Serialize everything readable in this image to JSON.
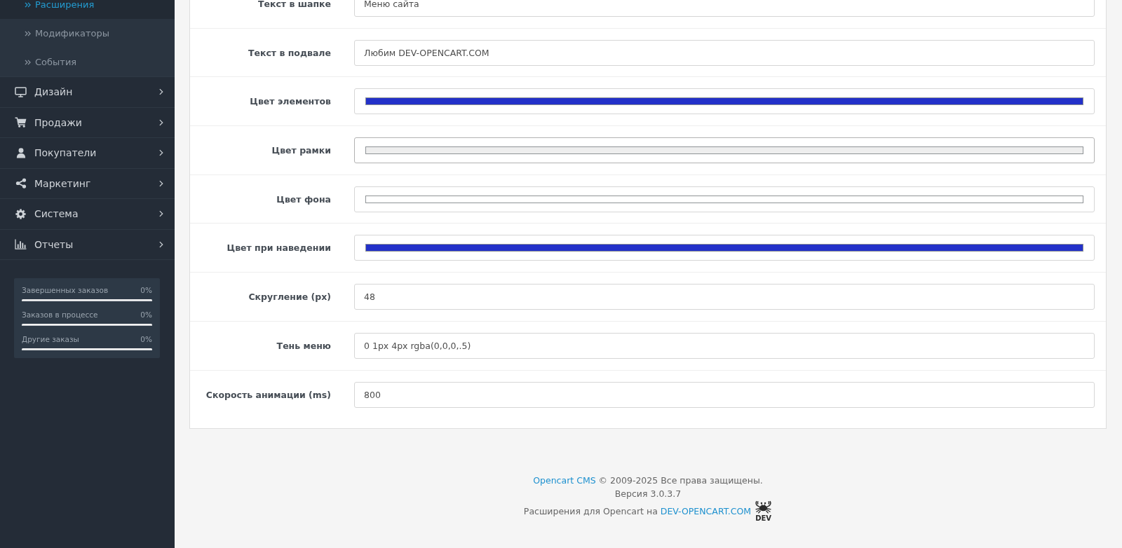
{
  "sidebar": {
    "submenu": [
      {
        "label": "Расширения",
        "selected": true
      },
      {
        "label": "Модификаторы",
        "selected": false
      },
      {
        "label": "События",
        "selected": false
      }
    ],
    "menu": [
      {
        "label": "Дизайн"
      },
      {
        "label": "Продажи"
      },
      {
        "label": "Покупатели"
      },
      {
        "label": "Маркетинг"
      },
      {
        "label": "Система"
      },
      {
        "label": "Отчеты"
      }
    ],
    "stats": [
      {
        "label": "Завершенных заказов",
        "value": "0%"
      },
      {
        "label": "Заказов в процессе",
        "value": "0%"
      },
      {
        "label": "Другие заказы",
        "value": "0%"
      }
    ]
  },
  "form": {
    "fields": [
      {
        "label": "Текст в шапке",
        "kind": "text",
        "value": "Меню сайта",
        "hovered": false
      },
      {
        "label": "Текст в подвале",
        "kind": "text",
        "value": "Любим DEV-OPENCART.COM",
        "hovered": false
      },
      {
        "label": "Цвет элементов",
        "kind": "color",
        "color": "#2331c9",
        "hovered": false
      },
      {
        "label": "Цвет рамки",
        "kind": "color",
        "color": "#eeeeee",
        "hovered": true
      },
      {
        "label": "Цвет фона",
        "kind": "color",
        "color": "#ffffff",
        "hovered": false
      },
      {
        "label": "Цвет при наведении",
        "kind": "color",
        "color": "#2331c9",
        "hovered": false
      },
      {
        "label": "Скругление (px)",
        "kind": "text",
        "value": "48",
        "hovered": false
      },
      {
        "label": "Тень меню",
        "kind": "text",
        "value": "0 1px 4px rgba(0,0,0,.5)",
        "hovered": false
      },
      {
        "label": "Скорость анимации (ms)",
        "kind": "text",
        "value": "800",
        "hovered": false
      }
    ]
  },
  "footer": {
    "copyright": {
      "link": "Opencart CMS",
      "text": "© 2009-2025 Все права защищены."
    },
    "version": "Версия 3.0.3.7",
    "extensions": {
      "text": "Расширения для Opencart на",
      "link": "DEV-OPENCART.COM"
    },
    "logo_text": "DEV"
  }
}
